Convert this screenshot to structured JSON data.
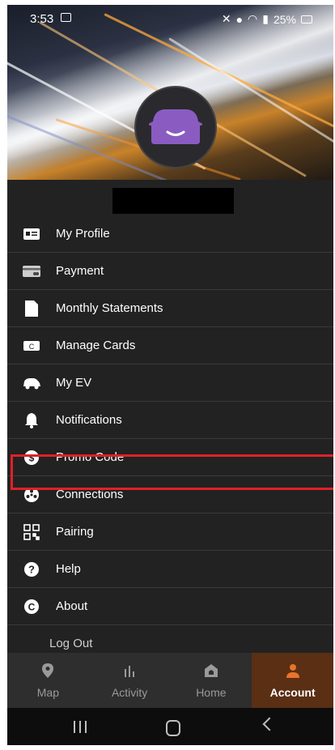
{
  "status_bar": {
    "time": "3:53",
    "battery": "25%"
  },
  "menu": {
    "items": [
      {
        "label": "My Profile",
        "icon": "id-card-icon"
      },
      {
        "label": "Payment",
        "icon": "credit-card-icon"
      },
      {
        "label": "Monthly Statements",
        "icon": "document-icon"
      },
      {
        "label": "Manage Cards",
        "icon": "charge-card-icon"
      },
      {
        "label": "My EV",
        "icon": "ev-car-icon"
      },
      {
        "label": "Notifications",
        "icon": "bell-icon"
      },
      {
        "label": "Promo Code",
        "icon": "promo-dollar-icon"
      },
      {
        "label": "Connections",
        "icon": "connections-icon"
      },
      {
        "label": "Pairing",
        "icon": "qr-code-icon"
      },
      {
        "label": "Help",
        "icon": "help-icon"
      },
      {
        "label": "About",
        "icon": "about-icon"
      }
    ],
    "logout": "Log Out"
  },
  "bottom_nav": {
    "tabs": [
      {
        "label": "Map",
        "icon": "map-pin-icon"
      },
      {
        "label": "Activity",
        "icon": "bar-chart-icon"
      },
      {
        "label": "Home",
        "icon": "home-icon"
      },
      {
        "label": "Account",
        "icon": "account-icon",
        "active": true
      }
    ]
  },
  "colors": {
    "accent": "#e8742a",
    "highlight": "#e0202a",
    "avatar_car": "#8a5cc2"
  }
}
